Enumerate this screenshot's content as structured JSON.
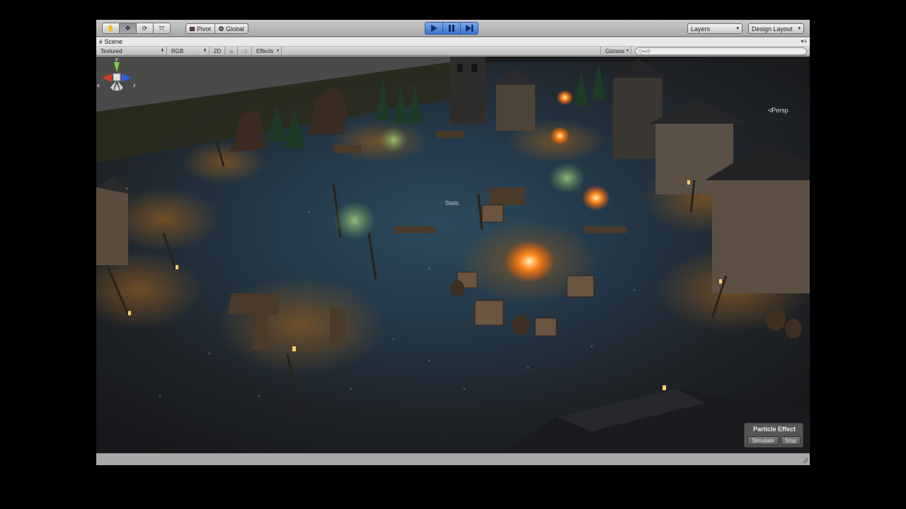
{
  "toolbar": {
    "tools": [
      {
        "name": "hand-tool",
        "icon": "hand-icon",
        "glyph": "✋",
        "active": false
      },
      {
        "name": "move-tool",
        "icon": "move-icon",
        "glyph": "✥",
        "active": true
      },
      {
        "name": "rotate-tool",
        "icon": "rotate-icon",
        "glyph": "⟳",
        "active": false
      },
      {
        "name": "scale-tool",
        "icon": "scale-icon",
        "glyph": "⤧",
        "active": false
      }
    ],
    "pivot_label": "Pivot",
    "global_label": "Global",
    "layers_label": "Layers",
    "layout_label": "Design Layout"
  },
  "tab": {
    "scene_label": "Scene"
  },
  "scene_toolbar": {
    "render_mode": "Textured",
    "color_mode": "RGB",
    "mode_2d": "2D",
    "effects_label": "Effects",
    "gizmos_label": "Gizmos",
    "search_placeholder": "Q▾All"
  },
  "viewport": {
    "static_label": "Static",
    "persp_label": "≮Persp",
    "gizmo_axes": {
      "x": "x",
      "y": "y",
      "z": "z"
    }
  },
  "particle_effect": {
    "title": "Particle Effect",
    "simulate_label": "Simulate",
    "stop_label": "Stop"
  },
  "colors": {
    "play_accent": "#3a74cf",
    "axis_x": "#d23a2a",
    "axis_y": "#7ad13a",
    "axis_z": "#2f5fd6",
    "fire": "#ff8a1e"
  }
}
